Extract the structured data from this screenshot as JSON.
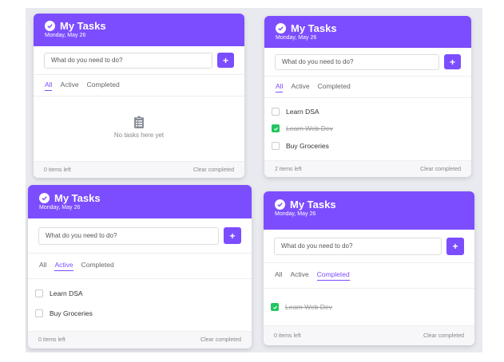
{
  "app": {
    "title": "My Tasks",
    "date": "Monday, May 26"
  },
  "input": {
    "placeholder": "What do you need to do?",
    "add_label": "+"
  },
  "tabs": [
    "All",
    "Active",
    "Completed"
  ],
  "footer": {
    "clear_label": "Clear completed"
  },
  "panels": [
    {
      "filter": "All",
      "items_left": "0 items left",
      "empty_text": "No tasks here yet",
      "items": []
    },
    {
      "filter": "All",
      "items_left": "2 items left",
      "items": [
        {
          "label": "Learn DSA",
          "done": false
        },
        {
          "label": "Learn Web Dev",
          "done": true
        },
        {
          "label": "Buy Groceries",
          "done": false
        }
      ]
    },
    {
      "filter": "Active",
      "items_left": "0 items left",
      "items": [
        {
          "label": "Learn DSA",
          "done": false
        },
        {
          "label": "Buy Groceries",
          "done": false
        }
      ]
    },
    {
      "filter": "Completed",
      "items_left": "0 items left",
      "items": [
        {
          "label": "Learn Web Dev",
          "done": true
        }
      ]
    }
  ],
  "colors": {
    "accent": "#7c4dff",
    "done": "#22c55e"
  }
}
